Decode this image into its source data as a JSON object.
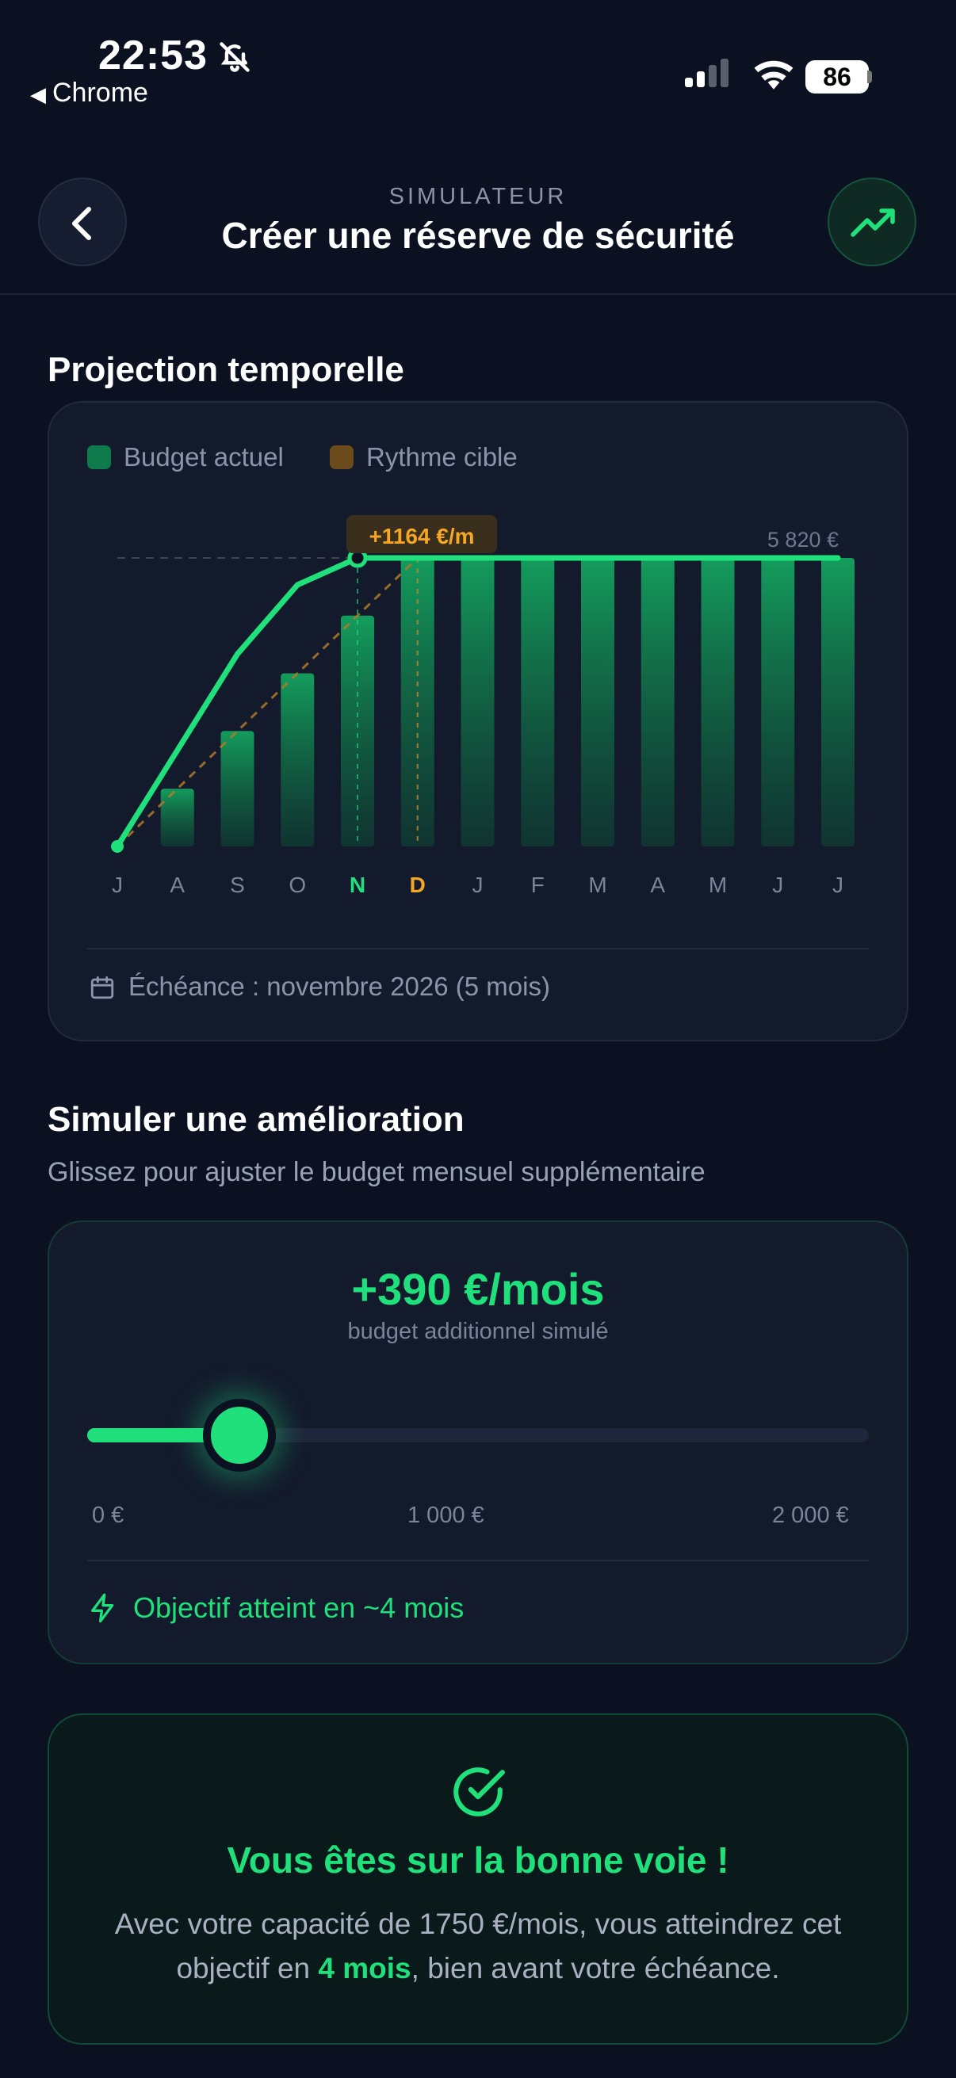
{
  "status_bar": {
    "time": "22:53",
    "back_app": "Chrome",
    "battery": "86",
    "icons": [
      "bell-slash-icon",
      "signal-icon",
      "wifi-icon",
      "battery-icon"
    ]
  },
  "header": {
    "kicker": "SIMULATEUR",
    "title": "Créer une réserve de sécurité",
    "back_icon": "chevron-left-icon",
    "action_icon": "trending-up-icon"
  },
  "projection": {
    "title": "Projection temporelle",
    "legend": [
      "Budget actuel",
      "Rythme cible"
    ],
    "deadline_icon": "calendar-icon",
    "deadline": "Échéance : novembre 2026 (5 mois)"
  },
  "chart_data": {
    "type": "bar",
    "categories": [
      "J",
      "A",
      "S",
      "O",
      "N",
      "D",
      "J",
      "F",
      "M",
      "A",
      "M",
      "J",
      "J"
    ],
    "series": [
      {
        "name": "Budget actuel",
        "values": [
          0,
          1164,
          2328,
          3492,
          4656,
          5820,
          5820,
          5820,
          5820,
          5820,
          5820,
          5820,
          5820
        ]
      },
      {
        "name": "Rythme cible",
        "values": [
          0,
          1164,
          2328,
          3492,
          4656,
          5820,
          5820,
          5820,
          5820,
          5820,
          5820,
          5820,
          5820
        ]
      }
    ],
    "line_values": [
      0,
      1940,
      3880,
      5820,
      5820,
      5820,
      5820,
      5820,
      5820,
      5820,
      5820,
      5820,
      5820
    ],
    "target_values": [
      0,
      1164,
      2328,
      3492,
      4656,
      5820
    ],
    "goal_value": 5820,
    "goal_label": "5 820 €",
    "rate_label": "+1164 €/m",
    "highlight": {
      "reached": "N",
      "deadline": "D"
    },
    "ylim": [
      0,
      5820
    ],
    "colors": {
      "budget": "#1fe07b",
      "target": "#c98a2c"
    },
    "legend_position": "top-left",
    "grid": false
  },
  "simulator": {
    "title": "Simuler une amélioration",
    "subtitle": "Glissez pour ajuster le budget mensuel supplémentaire",
    "amount": "+390 €/mois",
    "amount_caption": "budget additionnel simulé",
    "slider_value": 390,
    "slider_min": 0,
    "slider_max": 2000,
    "tick_min": "0 €",
    "tick_mid": "1 000 €",
    "tick_max": "2 000 €",
    "goal_icon": "lightning-icon",
    "goal_text": "Objectif atteint en ~4 mois"
  },
  "success": {
    "icon": "check-circle-icon",
    "title": "Vous êtes sur la bonne voie !",
    "text_before": "Avec votre capacité de 1750 €/mois, vous atteindrez cet objectif en ",
    "text_bold": "4 mois",
    "text_after": ", bien avant votre échéance."
  },
  "colors": {
    "accent": "#1fe07b",
    "warning": "#f5a623",
    "background": "#0b1120"
  }
}
